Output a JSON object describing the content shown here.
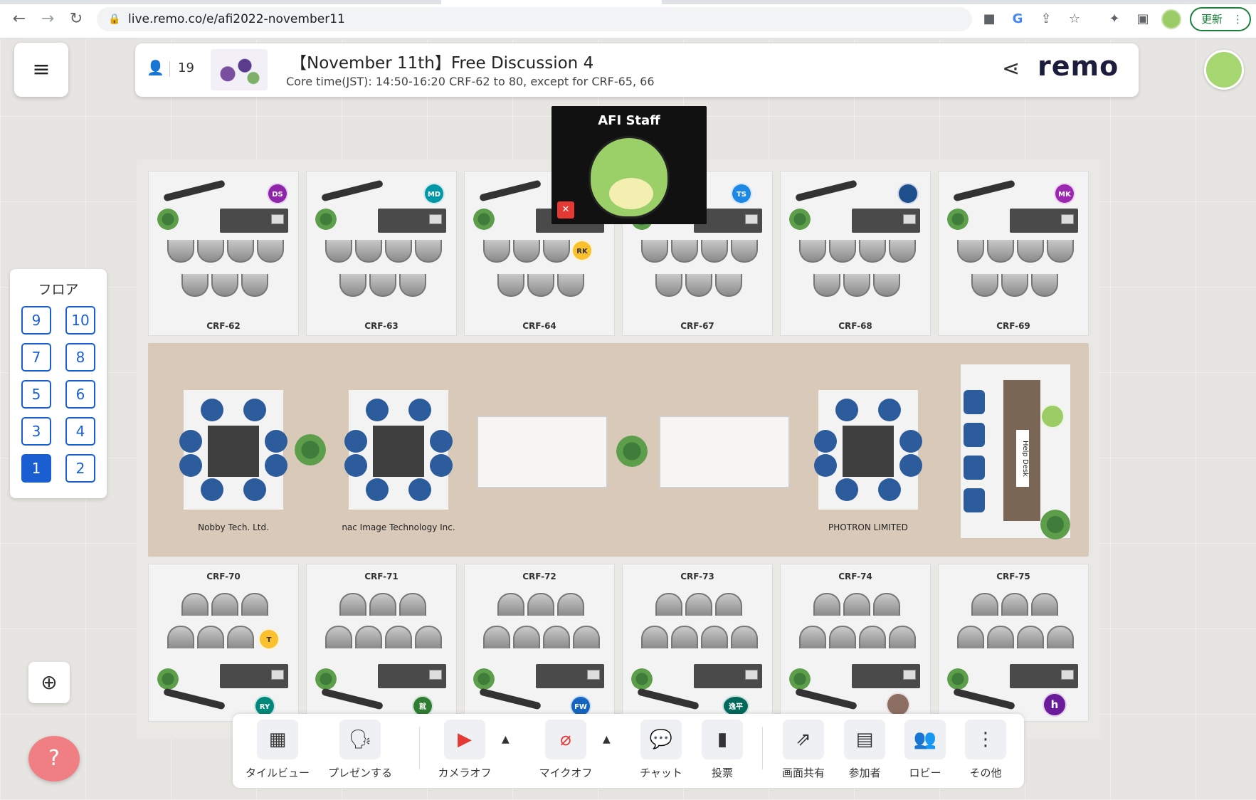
{
  "browser": {
    "url": "live.remo.co/e/afi2022-november11",
    "update_label": "更新"
  },
  "header": {
    "attendee_count": "19",
    "title": "【November 11th】Free Discussion 4",
    "subtitle": "Core time(JST): 14:50-16:20 CRF-62 to 80, except for CRF-65, 66",
    "brand": "remo"
  },
  "floor_panel": {
    "title": "フロア",
    "floors": [
      "9",
      "10",
      "7",
      "8",
      "5",
      "6",
      "3",
      "4",
      "1",
      "2"
    ],
    "active_floor": "1"
  },
  "staff_tile": {
    "name": "AFI Staff"
  },
  "rooms_top": [
    "CRF-62",
    "CRF-63",
    "CRF-64",
    "CRF-67",
    "CRF-68",
    "CRF-69"
  ],
  "rooms_bottom": [
    "CRF-70",
    "CRF-71",
    "CRF-72",
    "CRF-73",
    "CRF-74",
    "CRF-75"
  ],
  "sponsor_tables": [
    "Nobby Tech. Ltd.",
    "nac Image Technology Inc.",
    "PHOTRON LIMITED"
  ],
  "help_desk_label": "Help Desk",
  "badges": {
    "crf62": "DS",
    "crf63": "MD",
    "crf64": "RK",
    "crf67": "TS",
    "crf69": "MK",
    "crf70a": "T",
    "crf70b": "RY",
    "crf71": "就",
    "crf72": "FW",
    "crf73": "逸平",
    "crf75": "h"
  },
  "toolbar": {
    "tile_view": "タイルビュー",
    "present": "プレゼンする",
    "camera_off": "カメラオフ",
    "mic_off": "マイクオフ",
    "chat": "チャット",
    "poll": "投票",
    "screen_share": "画面共有",
    "participants": "参加者",
    "lobby": "ロビー",
    "more": "その他"
  },
  "colors": {
    "accent": "#1a5fd1",
    "brand_dot": "#ff5a5f",
    "off_red": "#e53935",
    "corridor": "#d8c9b8"
  }
}
